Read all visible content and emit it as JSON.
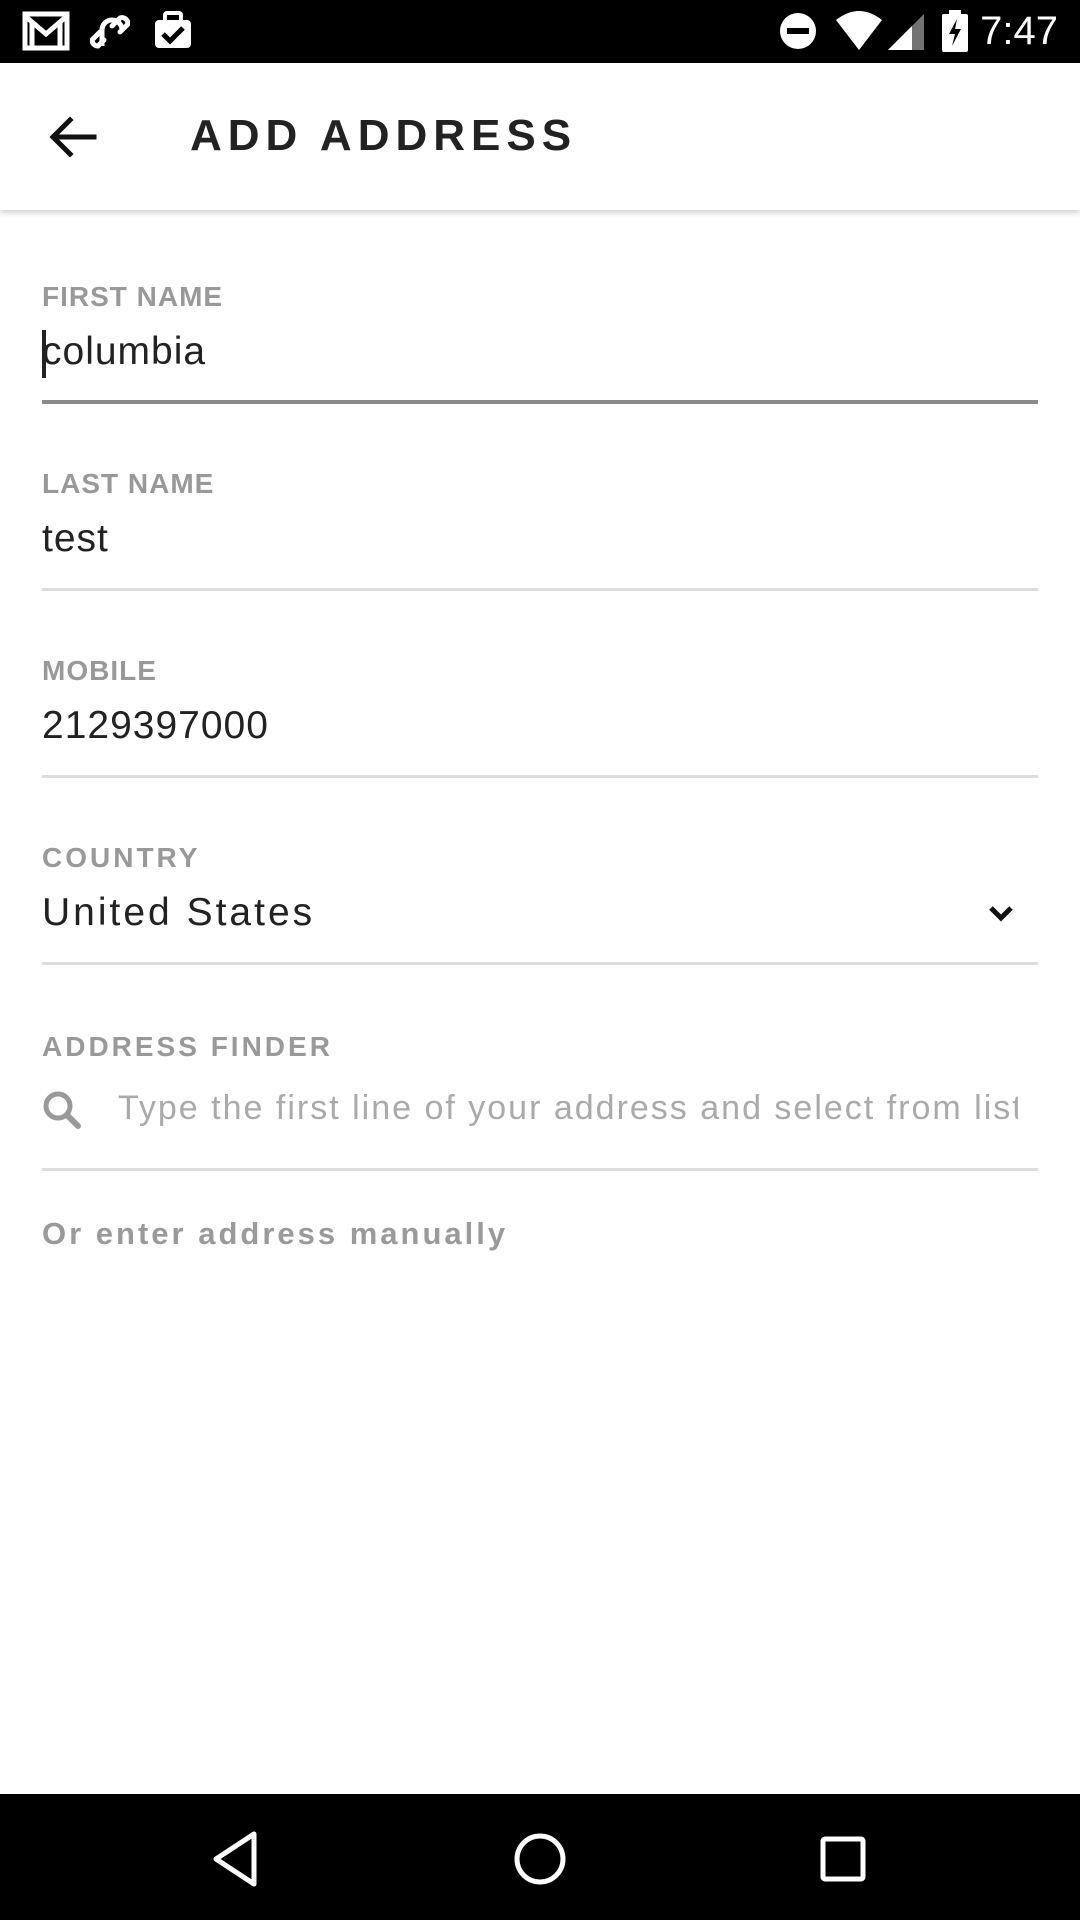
{
  "status_bar": {
    "time": "7:47",
    "icons": [
      "gmail-icon",
      "link-app-icon",
      "task-app-icon",
      "do-not-disturb-icon",
      "wifi-icon",
      "signal-icon",
      "battery-charging-icon"
    ]
  },
  "header": {
    "title": "ADD ADDRESS",
    "back_icon": "arrow-left-icon"
  },
  "form": {
    "first_name": {
      "label": "FIRST NAME",
      "value": "columbia"
    },
    "last_name": {
      "label": "LAST NAME",
      "value": "test"
    },
    "mobile": {
      "label": "MOBILE",
      "value": "2129397000"
    },
    "country": {
      "label": "COUNTRY",
      "value": "United States",
      "icon": "chevron-down-icon"
    },
    "address_finder": {
      "label": "ADDRESS FINDER",
      "placeholder": "Type the first line of your address and select from list",
      "icon": "search-icon"
    },
    "manual_link": "Or enter address manually"
  },
  "nav_bar": {
    "buttons": [
      "back-triangle-icon",
      "home-circle-icon",
      "recents-square-icon"
    ]
  },
  "colors": {
    "label": "#999999",
    "text": "#222222",
    "divider": "#dddddd",
    "active_divider": "#8a8a8a",
    "system_bar": "#000000"
  }
}
